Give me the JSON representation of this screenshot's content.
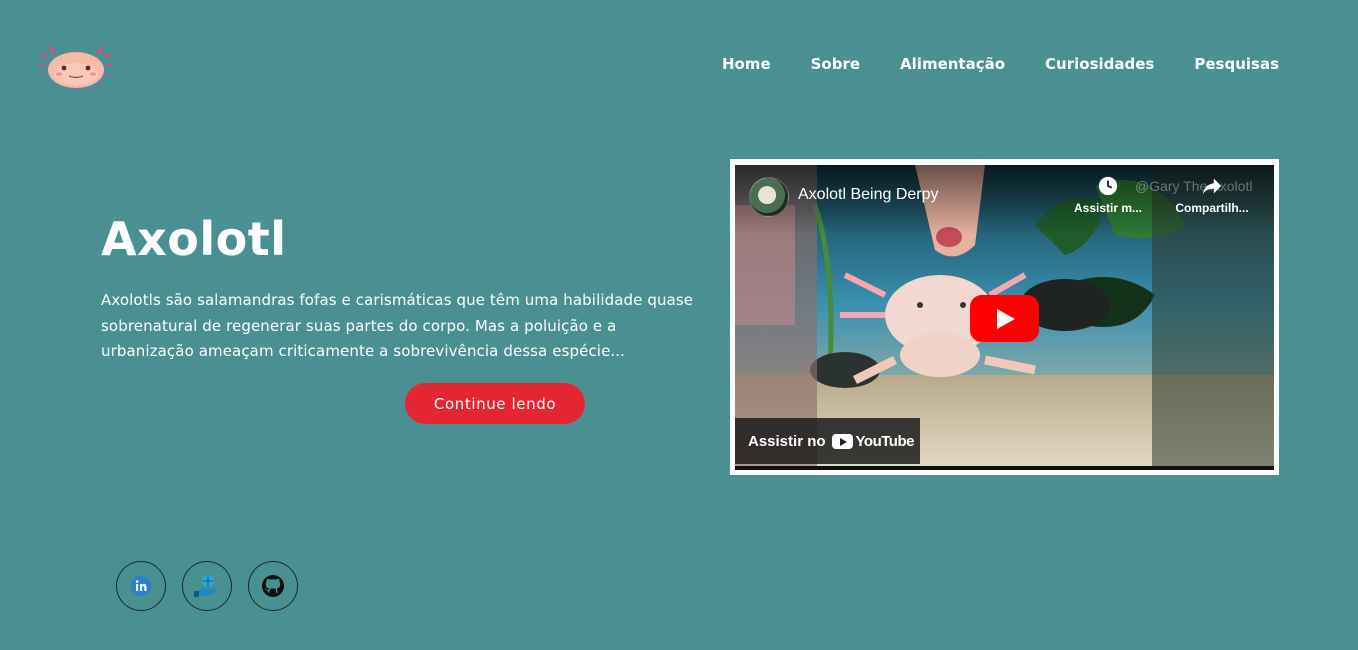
{
  "nav": {
    "items": [
      {
        "label": "Home"
      },
      {
        "label": "Sobre"
      },
      {
        "label": "Alimentação"
      },
      {
        "label": "Curiosidades"
      },
      {
        "label": "Pesquisas"
      }
    ]
  },
  "hero": {
    "title": "Axolotl",
    "text": "Axolotls são salamandras fofas e carismáticas que têm uma habilidade quase sobrenatural de regenerar suas partes do corpo. Mas a poluição e a urbanização ameaçam criticamente a sobrevivência dessa espécie...",
    "cta_label": "Continue lendo"
  },
  "video": {
    "title": "Axolotl Being Derpy",
    "channel_handle": "@Gary The Axolotl",
    "watch_later_label": "Assistir m...",
    "share_label": "Compartilh...",
    "watch_on_label": "Assistir no",
    "youtube_wordmark": "YouTube"
  },
  "colors": {
    "background": "#4a9093",
    "accent": "#e42630",
    "youtube_red": "#ff0000"
  },
  "socials": [
    {
      "icon": "linkedin-icon"
    },
    {
      "icon": "hand-globe-icon"
    },
    {
      "icon": "github-icon"
    }
  ]
}
